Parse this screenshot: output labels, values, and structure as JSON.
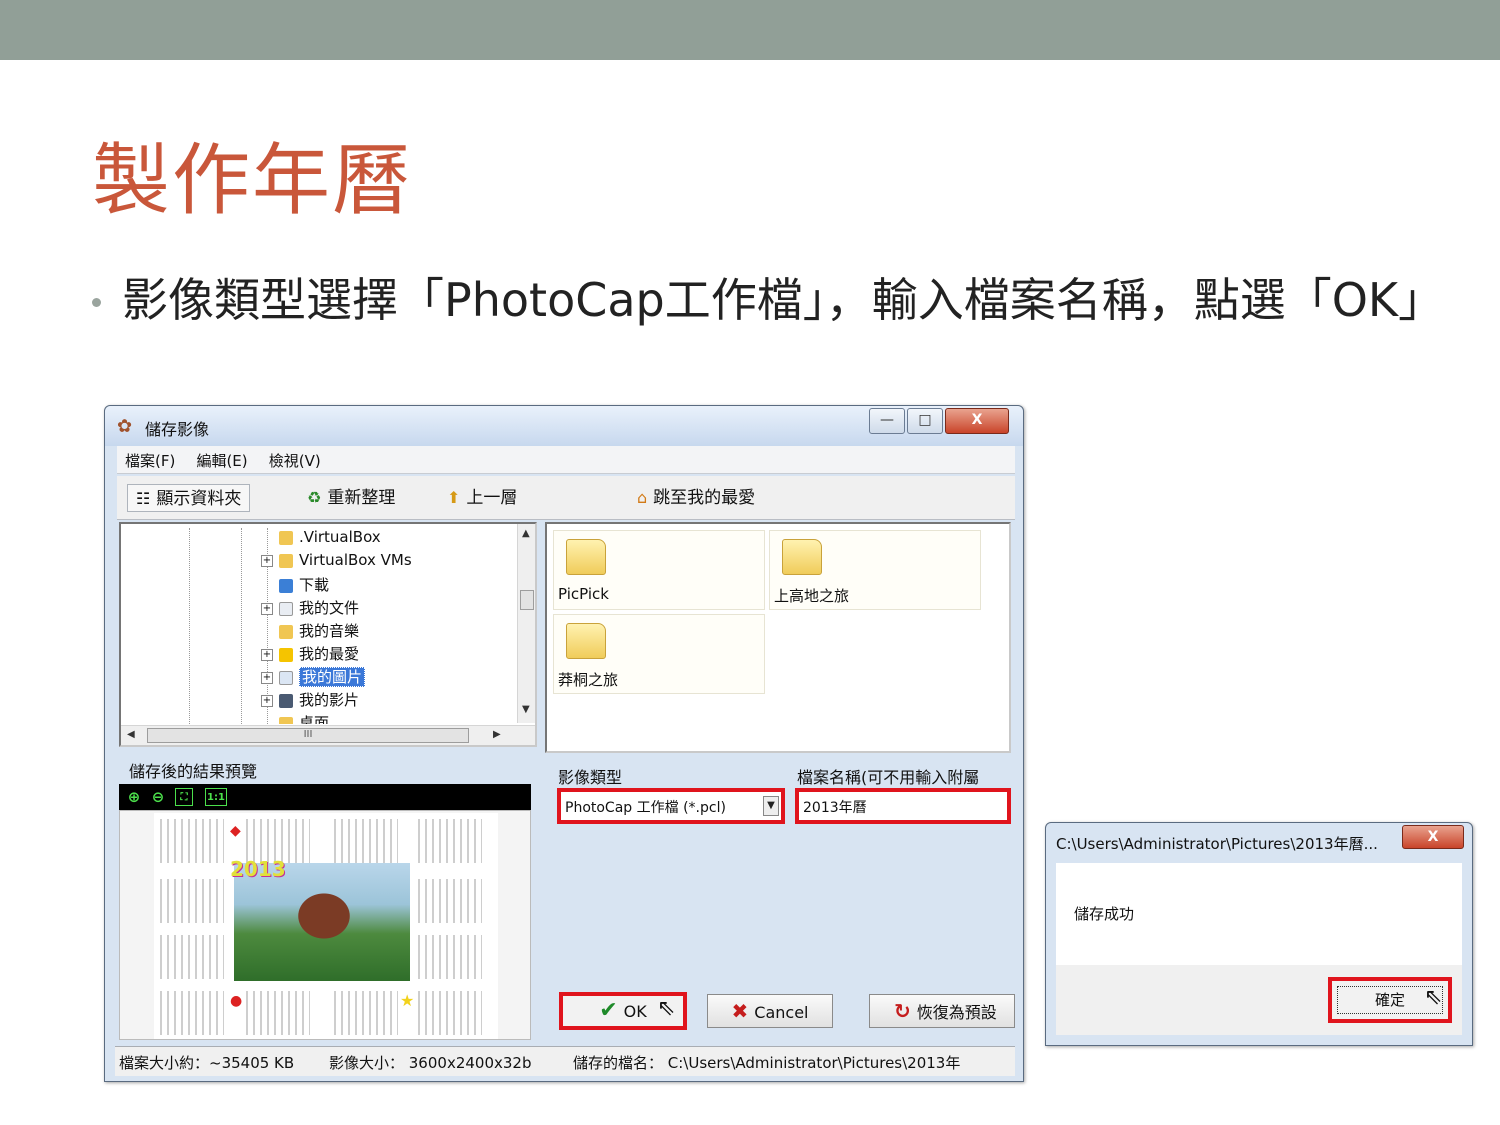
{
  "slide": {
    "title": "製作年曆",
    "bullet": "影像類型選擇「PhotoCap工作檔」，輸入檔案名稱，點選「OK」"
  },
  "dialog": {
    "title": "儲存影像",
    "window_buttons": {
      "minimize": "—",
      "maximize": "□",
      "close": "X"
    },
    "menu": [
      "檔案(F)",
      "編輯(E)",
      "檢視(V)"
    ],
    "toolbar": {
      "show_folder": "顯示資料夾",
      "refresh": "重新整理",
      "up": "上一層",
      "favorites": "跳至我的最愛"
    },
    "tree": [
      {
        "label": ".VirtualBox",
        "expander": ""
      },
      {
        "label": "VirtualBox VMs",
        "expander": "+"
      },
      {
        "label": "下載",
        "expander": ""
      },
      {
        "label": "我的文件",
        "expander": "+"
      },
      {
        "label": "我的音樂",
        "expander": ""
      },
      {
        "label": "我的最愛",
        "expander": "+"
      },
      {
        "label": "我的圖片",
        "expander": "+",
        "selected": true
      },
      {
        "label": "我的影片",
        "expander": "+"
      },
      {
        "label": "桌面",
        "expander": ""
      }
    ],
    "hscroll_grip": "III",
    "folders": [
      "PicPick",
      "上高地之旅",
      "莽桐之旅"
    ],
    "preview": {
      "label": "儲存後的結果預覽",
      "tools": [
        "zoom-in",
        "zoom-out",
        "fit",
        "1:1"
      ],
      "year_text": "2013"
    },
    "image_type_label": "影像類型",
    "image_type_value": "PhotoCap 工作檔 (*.pcl)",
    "filename_label": "檔案名稱(可不用輸入附屬",
    "filename_value": "2013年曆",
    "buttons": {
      "ok": "OK",
      "cancel": "Cancel",
      "restore": "恢復為預設"
    },
    "status": {
      "file_size": "檔案大小約：~35405 KB",
      "image_size": "影像大小： 3600x2400x32b",
      "saved_name": "儲存的檔名： C:\\Users\\Administrator\\Pictures\\2013年"
    }
  },
  "messagebox": {
    "title": "C:\\Users\\Administrator\\Pictures\\2013年曆...",
    "close": "X",
    "message": "儲存成功",
    "ok": "確定"
  },
  "colors": {
    "accent_red": "#e0141d",
    "title_color": "#c9573a",
    "top_band": "#919f97"
  }
}
